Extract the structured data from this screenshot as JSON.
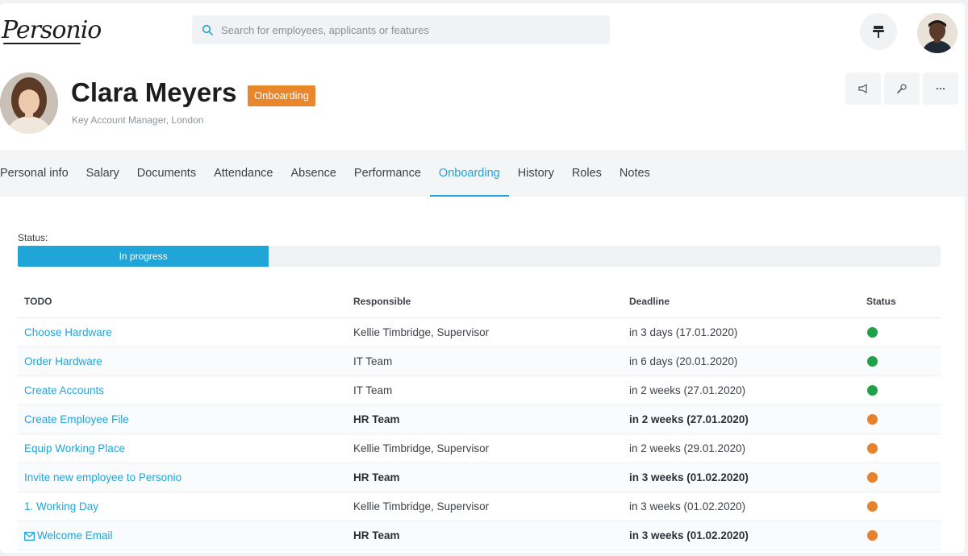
{
  "app": {
    "logo_text": "Personio",
    "search_placeholder": "Search for employees, applicants or features"
  },
  "profile": {
    "name": "Clara Meyers",
    "stage_badge": "Onboarding",
    "subtitle": "Key Account Manager, London"
  },
  "tabs": [
    {
      "label": "Personal info",
      "active": false
    },
    {
      "label": "Salary",
      "active": false
    },
    {
      "label": "Documents",
      "active": false
    },
    {
      "label": "Attendance",
      "active": false
    },
    {
      "label": "Absence",
      "active": false
    },
    {
      "label": "Performance",
      "active": false
    },
    {
      "label": "Onboarding",
      "active": true
    },
    {
      "label": "History",
      "active": false
    },
    {
      "label": "Roles",
      "active": false
    },
    {
      "label": "Notes",
      "active": false
    }
  ],
  "onboarding": {
    "status_label": "Status:",
    "progress_text": "In progress",
    "progress_fraction": 0.272,
    "columns": {
      "todo": "TODO",
      "responsible": "Responsible",
      "deadline": "Deadline",
      "status": "Status"
    },
    "rows": [
      {
        "task": "Choose Hardware",
        "responsible": "Kellie Timbridge, Supervisor",
        "deadline": "in 3 days (17.01.2020)",
        "status": "done",
        "emphasis": false
      },
      {
        "task": "Order Hardware",
        "responsible": "IT Team",
        "deadline": "in 6 days (20.01.2020)",
        "status": "done",
        "emphasis": false
      },
      {
        "task": "Create Accounts",
        "responsible": "IT Team",
        "deadline": "in 2 weeks (27.01.2020)",
        "status": "done",
        "emphasis": false
      },
      {
        "task": "Create Employee File",
        "responsible": "HR Team",
        "deadline": "in 2 weeks (27.01.2020)",
        "status": "open",
        "emphasis": true
      },
      {
        "task": "Equip Working Place",
        "responsible": "Kellie Timbridge, Supervisor",
        "deadline": "in 2 weeks (29.01.2020)",
        "status": "open",
        "emphasis": false
      },
      {
        "task": "Invite new employee to Personio",
        "responsible": "HR Team",
        "deadline": "in 3 weeks (01.02.2020)",
        "status": "open",
        "emphasis": true
      },
      {
        "task": "1. Working Day",
        "responsible": "Kellie Timbridge, Supervisor",
        "deadline": "in 3 weeks (01.02.2020)",
        "status": "open",
        "emphasis": false
      },
      {
        "task": "Welcome Email",
        "responsible": "HR Team",
        "deadline": "in 3 weeks (01.02.2020)",
        "status": "open",
        "emphasis": true,
        "icon": "mail-icon"
      }
    ]
  },
  "colors": {
    "accent": "#1fa5d8",
    "badge": "#e9872d",
    "status_done": "#1fa04a",
    "status_open": "#e6822c"
  },
  "icons": [
    "search-icon",
    "pin-icon",
    "megaphone-icon",
    "wrench-icon",
    "more-icon",
    "mail-icon"
  ]
}
